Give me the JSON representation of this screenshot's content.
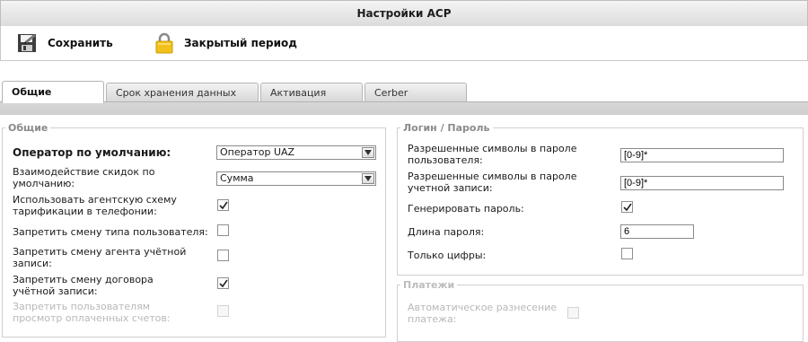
{
  "window": {
    "title": "Настройки АСР"
  },
  "toolbar": {
    "save_label": "Сохранить",
    "closed_period_label": "Закрытый период"
  },
  "tabs": [
    {
      "label": "Общие",
      "active": true
    },
    {
      "label": "Срок хранения данных",
      "active": false
    },
    {
      "label": "Активация",
      "active": false
    },
    {
      "label": "Cerber",
      "active": false
    }
  ],
  "general": {
    "legend": "Общие",
    "default_operator": {
      "label": "Оператор по умолчанию:",
      "value": "Оператор UAZ"
    },
    "discount_interaction": {
      "label": "Взаимодействие скидок по умолчанию:",
      "value": "Сумма"
    },
    "agent_scheme": {
      "label": "Использовать агентскую схему тарификации в телефонии:",
      "checked": true
    },
    "forbid_user_type": {
      "label": "Запретить смену типа пользователя:",
      "checked": false
    },
    "forbid_agent": {
      "label": "Запретить смену агента учётной записи:",
      "checked": false
    },
    "forbid_contract": {
      "label": "Запретить смену договора учётной записи:",
      "checked": true
    },
    "forbid_paid_view": {
      "label": "Запретить пользователям просмотр оплаченных счетов:",
      "checked": false,
      "disabled": true
    }
  },
  "login": {
    "legend": "Логин / Пароль",
    "user_pwd_chars": {
      "label": "Разрешенные символы в пароле пользователя:",
      "value": "[0-9]*"
    },
    "acc_pwd_chars": {
      "label": "Разрешенные символы в пароле учетной записи:",
      "value": "[0-9]*"
    },
    "generate": {
      "label": "Генерировать пароль:",
      "checked": true
    },
    "length": {
      "label": "Длина пароля:",
      "value": "6"
    },
    "digits_only": {
      "label": "Только цифры:",
      "checked": false
    }
  },
  "payments": {
    "legend": "Платежи",
    "auto_split": {
      "label": "Автоматическое разнесение платежа:",
      "checked": false,
      "disabled": true
    }
  }
}
